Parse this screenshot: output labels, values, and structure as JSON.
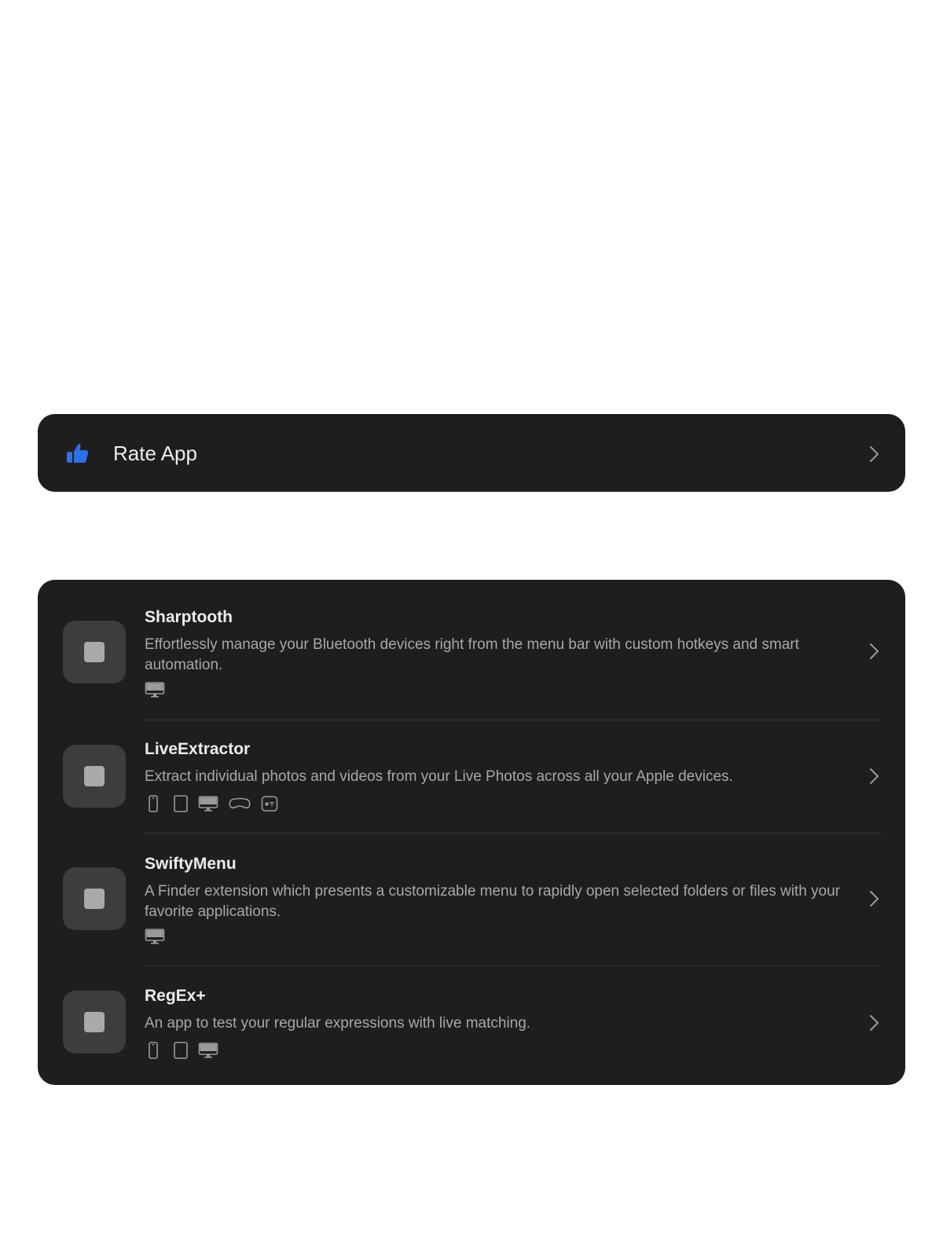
{
  "rate": {
    "label": "Rate App",
    "icon": "thumbs-up-icon",
    "icon_color": "#2f6fe8"
  },
  "apps": [
    {
      "name": "Sharptooth",
      "description": "Effortlessly manage your Bluetooth devices right from the menu bar with custom hotkeys and smart automation.",
      "platforms": [
        "mac"
      ]
    },
    {
      "name": "LiveExtractor",
      "description": "Extract individual photos and videos from your Live Photos across all your Apple devices.",
      "platforms": [
        "iphone",
        "ipad",
        "mac",
        "vision",
        "tv"
      ]
    },
    {
      "name": "SwiftyMenu",
      "description": "A Finder extension which presents a customizable menu to rapidly open selected folders or files with your favorite applications.",
      "platforms": [
        "mac"
      ]
    },
    {
      "name": "RegEx+",
      "description": "An app to test your regular expressions with live matching.",
      "platforms": [
        "iphone",
        "ipad",
        "mac"
      ]
    }
  ],
  "colors": {
    "card_background": "#1e1e1e",
    "app_icon_tile": "#3d3d3d",
    "title_text": "#ececec",
    "secondary_text": "#a8a8a8",
    "chevron": "#9a9a9a"
  }
}
